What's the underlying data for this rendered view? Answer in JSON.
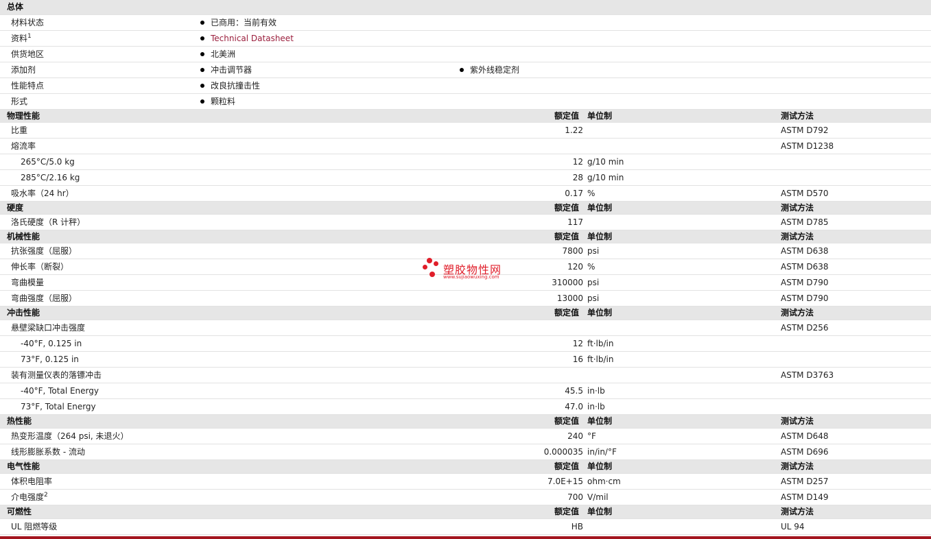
{
  "general": {
    "title": "总体",
    "rows": [
      {
        "label": "材料状态",
        "values": [
          "已商用：当前有效"
        ]
      },
      {
        "label": "资料",
        "sup": "1",
        "values": [
          "Technical Datasheet"
        ],
        "link": true
      },
      {
        "label": "供货地区",
        "values": [
          "北美洲"
        ]
      },
      {
        "label": "添加剂",
        "values": [
          "冲击调节器",
          "紫外线稳定剂"
        ]
      },
      {
        "label": "性能特点",
        "values": [
          "改良抗撞击性"
        ]
      },
      {
        "label": "形式",
        "values": [
          "颗粒料"
        ]
      }
    ]
  },
  "column_headers": {
    "value": "额定值",
    "unit": "单位制",
    "test": "测试方法"
  },
  "sections": [
    {
      "title": "物理性能",
      "rows": [
        {
          "label": "比重",
          "value": "1.22",
          "unit": "",
          "test": "ASTM D792"
        },
        {
          "label": "熔流率",
          "value": "",
          "unit": "",
          "test": "ASTM D1238"
        },
        {
          "label": "265°C/5.0 kg",
          "sub": true,
          "value": "12",
          "unit": "g/10 min",
          "test": ""
        },
        {
          "label": "285°C/2.16 kg",
          "sub": true,
          "value": "28",
          "unit": "g/10 min",
          "test": ""
        },
        {
          "label": "吸水率（24 hr）",
          "value": "0.17",
          "unit": "%",
          "test": "ASTM D570"
        }
      ]
    },
    {
      "title": "硬度",
      "rows": [
        {
          "label": "洛氏硬度（R 计秤）",
          "value": "117",
          "unit": "",
          "test": "ASTM D785"
        }
      ]
    },
    {
      "title": "机械性能",
      "rows": [
        {
          "label": "抗张强度（屈服）",
          "value": "7800",
          "unit": "psi",
          "test": "ASTM D638"
        },
        {
          "label": "伸长率（断裂）",
          "value": "120",
          "unit": "%",
          "test": "ASTM D638"
        },
        {
          "label": "弯曲模量",
          "value": "310000",
          "unit": "psi",
          "test": "ASTM D790"
        },
        {
          "label": "弯曲强度（屈服）",
          "value": "13000",
          "unit": "psi",
          "test": "ASTM D790"
        }
      ]
    },
    {
      "title": "冲击性能",
      "rows": [
        {
          "label": "悬壁梁缺口冲击强度",
          "value": "",
          "unit": "",
          "test": "ASTM D256"
        },
        {
          "label": "-40°F, 0.125 in",
          "sub": true,
          "value": "12",
          "unit": "ft·lb/in",
          "test": ""
        },
        {
          "label": "73°F, 0.125 in",
          "sub": true,
          "value": "16",
          "unit": "ft·lb/in",
          "test": ""
        },
        {
          "label": "装有测量仪表的落镖冲击",
          "value": "",
          "unit": "",
          "test": "ASTM D3763"
        },
        {
          "label": "-40°F, Total Energy",
          "sub": true,
          "value": "45.5",
          "unit": "in·lb",
          "test": ""
        },
        {
          "label": "73°F, Total Energy",
          "sub": true,
          "value": "47.0",
          "unit": "in·lb",
          "test": ""
        }
      ]
    },
    {
      "title": "热性能",
      "rows": [
        {
          "label": "热变形温度（264 psi, 未退火）",
          "value": "240",
          "unit": "°F",
          "test": "ASTM D648"
        },
        {
          "label": "线形膨胀系数 - 流动",
          "value": "0.000035",
          "unit": "in/in/°F",
          "test": "ASTM D696"
        }
      ]
    },
    {
      "title": "电气性能",
      "rows": [
        {
          "label": "体积电阻率",
          "value": "7.0E+15",
          "unit": "ohm·cm",
          "test": "ASTM D257"
        },
        {
          "label": "介电强度",
          "sup": "2",
          "value": "700",
          "unit": "V/mil",
          "test": "ASTM D149"
        }
      ]
    },
    {
      "title": "可燃性",
      "rows": [
        {
          "label": "UL 阻燃等级",
          "value": "HB",
          "unit": "",
          "test": "UL 94"
        }
      ]
    }
  ],
  "watermark": {
    "text": "塑胶物性网",
    "url": "www.sujiaowuxing.com"
  },
  "colors": {
    "header_bg": "#e6e6e6",
    "link": "#9b1f3d",
    "watermark": "#e01e2a"
  }
}
